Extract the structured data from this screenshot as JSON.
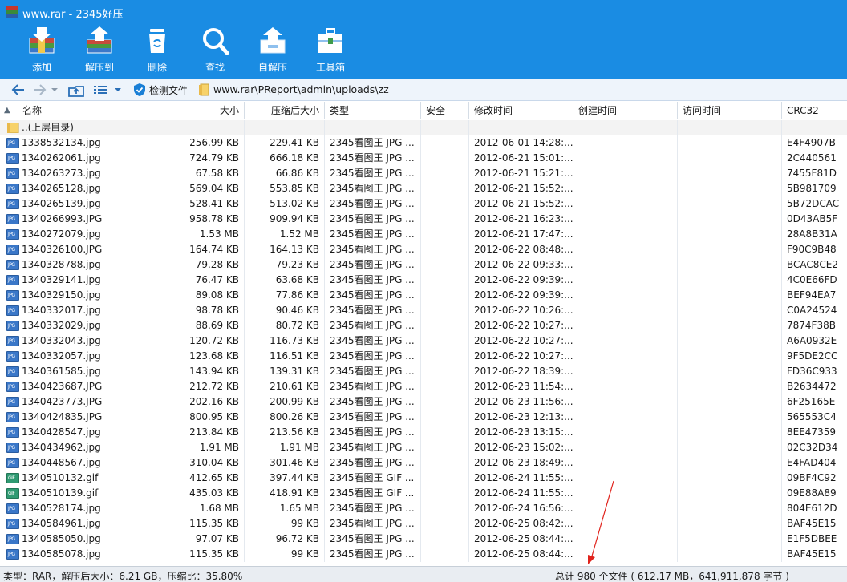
{
  "window": {
    "title": "www.rar - 2345好压"
  },
  "toolbar": {
    "buttons": [
      {
        "label": "添加",
        "icon": "add-archive-icon"
      },
      {
        "label": "解压到",
        "icon": "extract-to-icon"
      },
      {
        "label": "删除",
        "icon": "recycle-bin-icon"
      },
      {
        "label": "查找",
        "icon": "magnifier-icon"
      },
      {
        "label": "自解压",
        "icon": "self-extract-icon"
      },
      {
        "label": "工具箱",
        "icon": "toolbox-icon"
      }
    ]
  },
  "address": {
    "detect_label": "检测文件",
    "path": "www.rar\\PReport\\admin\\uploads\\zz"
  },
  "columns": {
    "name": "名称",
    "size": "大小",
    "csize": "压缩后大小",
    "type": "类型",
    "security": "安全",
    "modified": "修改时间",
    "created": "创建时间",
    "accessed": "访问时间",
    "crc": "CRC32"
  },
  "parent_row": {
    "name": "..(上层目录)"
  },
  "files": [
    {
      "name": "1338532134.jpg",
      "size": "256.99 KB",
      "csize": "229.41 KB",
      "type": "2345看图王 JPG ...",
      "modified": "2012-06-01 14:28:...",
      "crc": "E4F4907B",
      "kind": "jpg"
    },
    {
      "name": "1340262061.jpg",
      "size": "724.79 KB",
      "csize": "666.18 KB",
      "type": "2345看图王 JPG ...",
      "modified": "2012-06-21 15:01:...",
      "crc": "2C440561",
      "kind": "jpg"
    },
    {
      "name": "1340263273.jpg",
      "size": "67.58 KB",
      "csize": "66.86 KB",
      "type": "2345看图王 JPG ...",
      "modified": "2012-06-21 15:21:...",
      "crc": "7455F81D",
      "kind": "jpg"
    },
    {
      "name": "1340265128.jpg",
      "size": "569.04 KB",
      "csize": "553.85 KB",
      "type": "2345看图王 JPG ...",
      "modified": "2012-06-21 15:52:...",
      "crc": "5B981709",
      "kind": "jpg"
    },
    {
      "name": "1340265139.jpg",
      "size": "528.41 KB",
      "csize": "513.02 KB",
      "type": "2345看图王 JPG ...",
      "modified": "2012-06-21 15:52:...",
      "crc": "5B72DCAC",
      "kind": "jpg"
    },
    {
      "name": "1340266993.JPG",
      "size": "958.78 KB",
      "csize": "909.94 KB",
      "type": "2345看图王 JPG ...",
      "modified": "2012-06-21 16:23:...",
      "crc": "0D43AB5F",
      "kind": "jpg"
    },
    {
      "name": "1340272079.jpg",
      "size": "1.53 MB",
      "csize": "1.52 MB",
      "type": "2345看图王 JPG ...",
      "modified": "2012-06-21 17:47:...",
      "crc": "28A8B31A",
      "kind": "jpg"
    },
    {
      "name": "1340326100.JPG",
      "size": "164.74 KB",
      "csize": "164.13 KB",
      "type": "2345看图王 JPG ...",
      "modified": "2012-06-22 08:48:...",
      "crc": "F90C9B48",
      "kind": "jpg"
    },
    {
      "name": "1340328788.jpg",
      "size": "79.28 KB",
      "csize": "79.23 KB",
      "type": "2345看图王 JPG ...",
      "modified": "2012-06-22 09:33:...",
      "crc": "BCAC8CE2",
      "kind": "jpg"
    },
    {
      "name": "1340329141.jpg",
      "size": "76.47 KB",
      "csize": "63.68 KB",
      "type": "2345看图王 JPG ...",
      "modified": "2012-06-22 09:39:...",
      "crc": "4C0E66FD",
      "kind": "jpg"
    },
    {
      "name": "1340329150.jpg",
      "size": "89.08 KB",
      "csize": "77.86 KB",
      "type": "2345看图王 JPG ...",
      "modified": "2012-06-22 09:39:...",
      "crc": "BEF94EA7",
      "kind": "jpg"
    },
    {
      "name": "1340332017.jpg",
      "size": "98.78 KB",
      "csize": "90.46 KB",
      "type": "2345看图王 JPG ...",
      "modified": "2012-06-22 10:26:...",
      "crc": "C0A24524",
      "kind": "jpg"
    },
    {
      "name": "1340332029.jpg",
      "size": "88.69 KB",
      "csize": "80.72 KB",
      "type": "2345看图王 JPG ...",
      "modified": "2012-06-22 10:27:...",
      "crc": "7874F38B",
      "kind": "jpg"
    },
    {
      "name": "1340332043.jpg",
      "size": "120.72 KB",
      "csize": "116.73 KB",
      "type": "2345看图王 JPG ...",
      "modified": "2012-06-22 10:27:...",
      "crc": "A6A0932E",
      "kind": "jpg"
    },
    {
      "name": "1340332057.jpg",
      "size": "123.68 KB",
      "csize": "116.51 KB",
      "type": "2345看图王 JPG ...",
      "modified": "2012-06-22 10:27:...",
      "crc": "9F5DE2CC",
      "kind": "jpg"
    },
    {
      "name": "1340361585.jpg",
      "size": "143.94 KB",
      "csize": "139.31 KB",
      "type": "2345看图王 JPG ...",
      "modified": "2012-06-22 18:39:...",
      "crc": "FD36C933",
      "kind": "jpg"
    },
    {
      "name": "1340423687.JPG",
      "size": "212.72 KB",
      "csize": "210.61 KB",
      "type": "2345看图王 JPG ...",
      "modified": "2012-06-23 11:54:...",
      "crc": "B2634472",
      "kind": "jpg"
    },
    {
      "name": "1340423773.JPG",
      "size": "202.16 KB",
      "csize": "200.99 KB",
      "type": "2345看图王 JPG ...",
      "modified": "2012-06-23 11:56:...",
      "crc": "6F25165E",
      "kind": "jpg"
    },
    {
      "name": "1340424835.JPG",
      "size": "800.95 KB",
      "csize": "800.26 KB",
      "type": "2345看图王 JPG ...",
      "modified": "2012-06-23 12:13:...",
      "crc": "565553C4",
      "kind": "jpg"
    },
    {
      "name": "1340428547.jpg",
      "size": "213.84 KB",
      "csize": "213.56 KB",
      "type": "2345看图王 JPG ...",
      "modified": "2012-06-23 13:15:...",
      "crc": "8EE47359",
      "kind": "jpg"
    },
    {
      "name": "1340434962.jpg",
      "size": "1.91 MB",
      "csize": "1.91 MB",
      "type": "2345看图王 JPG ...",
      "modified": "2012-06-23 15:02:...",
      "crc": "02C32D34",
      "kind": "jpg"
    },
    {
      "name": "1340448567.jpg",
      "size": "310.04 KB",
      "csize": "301.46 KB",
      "type": "2345看图王 JPG ...",
      "modified": "2012-06-23 18:49:...",
      "crc": "E4FAD404",
      "kind": "jpg"
    },
    {
      "name": "1340510132.gif",
      "size": "412.65 KB",
      "csize": "397.44 KB",
      "type": "2345看图王 GIF ...",
      "modified": "2012-06-24 11:55:...",
      "crc": "09BF4C92",
      "kind": "gif"
    },
    {
      "name": "1340510139.gif",
      "size": "435.03 KB",
      "csize": "418.91 KB",
      "type": "2345看图王 GIF ...",
      "modified": "2012-06-24 11:55:...",
      "crc": "09E88A89",
      "kind": "gif"
    },
    {
      "name": "1340528174.jpg",
      "size": "1.68 MB",
      "csize": "1.65 MB",
      "type": "2345看图王 JPG ...",
      "modified": "2012-06-24 16:56:...",
      "crc": "804E612D",
      "kind": "jpg"
    },
    {
      "name": "1340584961.jpg",
      "size": "115.35 KB",
      "csize": "99 KB",
      "type": "2345看图王 JPG ...",
      "modified": "2012-06-25 08:42:...",
      "crc": "BAF45E15",
      "kind": "jpg"
    },
    {
      "name": "1340585050.jpg",
      "size": "97.07 KB",
      "csize": "96.72 KB",
      "type": "2345看图王 JPG ...",
      "modified": "2012-06-25 08:44:...",
      "crc": "E1F5DBEE",
      "kind": "jpg"
    },
    {
      "name": "1340585078.jpg",
      "size": "115.35 KB",
      "csize": "99 KB",
      "type": "2345看图王 JPG ...",
      "modified": "2012-06-25 08:44:...",
      "crc": "BAF45E15",
      "kind": "jpg"
    }
  ],
  "status": {
    "left": "类型：RAR，解压后大小：6.21 GB，压缩比：35.80%",
    "right": "总计 980 个文件 ( 612.17 MB，641,911,878 字节 )"
  },
  "colors": {
    "toolbar_blue": "#1a8ce3",
    "annotation_red": "#e0231c"
  }
}
